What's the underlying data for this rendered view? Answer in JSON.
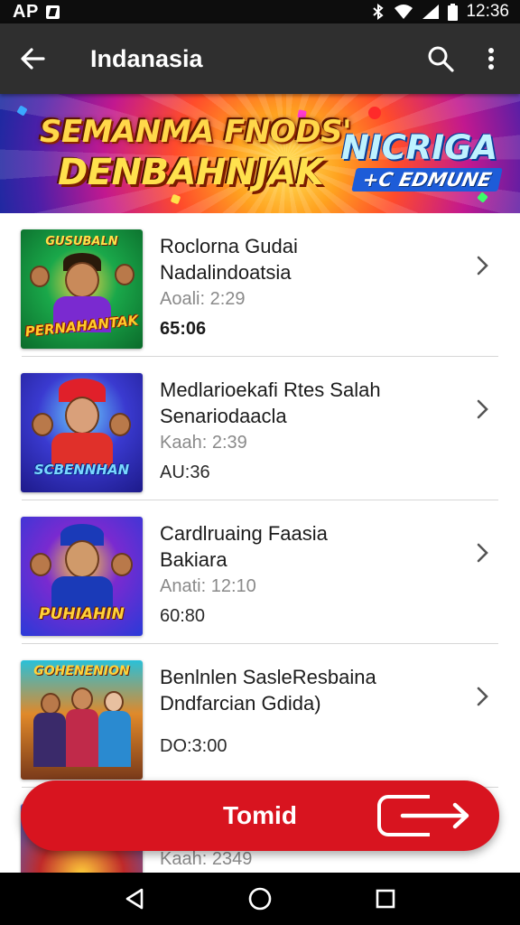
{
  "status_bar": {
    "left_label": "AP",
    "time": "12:36",
    "icons": [
      "notification-icon",
      "bluetooth-icon",
      "wifi-icon",
      "signal-icon",
      "battery-icon"
    ]
  },
  "app_bar": {
    "title": "Indanasia",
    "icons": [
      "back-arrow-icon",
      "search-icon",
      "more-vert-icon"
    ]
  },
  "banner": {
    "line1": "SEMANMA FNODS'",
    "line2": "DENBAHNJAK",
    "right_line1": "NICRIGA",
    "right_line2": "+C EDMUNE"
  },
  "items": [
    {
      "title_line1": "Roclorna Gudai",
      "title_line2": "Nadalindoatsia",
      "meta": "Aoali: 2:29",
      "duration": "65:06",
      "thumb_text_top": "GUSUBALN",
      "thumb_text_bottom": "PERNAHANTAK",
      "thumb_colors": [
        "#1aa84a",
        "#0b6b2b",
        "#f2c230"
      ]
    },
    {
      "title_line1": "Medlarioekafi Rtes Salah",
      "title_line2": "Senariodaacla",
      "meta": "Kaah: 2:39",
      "duration": "AU:36",
      "thumb_text_top": "",
      "thumb_text_bottom": "SCBENNHAN",
      "thumb_colors": [
        "#3a3ad0",
        "#1d1a8a",
        "#ff3a2a"
      ]
    },
    {
      "title_line1": "Cardlruaing Faasia",
      "title_line2": "Bakiara",
      "meta": "Anati: 12:10",
      "duration": "60:80",
      "thumb_text_top": "",
      "thumb_text_bottom": "PUHIAHIN",
      "thumb_colors": [
        "#2a3ad8",
        "#7a2ad0",
        "#ffd23a"
      ]
    },
    {
      "title_line1": "Benlnlen SasleResbaina",
      "title_line2": "Dndfarcian Gdida)",
      "meta": "",
      "duration": "DO:3:00",
      "thumb_text_top": "GOHENENION",
      "thumb_text_bottom": "",
      "thumb_colors": [
        "#e0892a",
        "#7a3a1a",
        "#2ac0d8"
      ]
    },
    {
      "title_line1": "",
      "title_line2": "",
      "meta": "Kaah: 2349",
      "duration": "",
      "thumb_text_top": "",
      "thumb_text_bottom": "",
      "thumb_colors": [
        "#3a6ad8",
        "#c02a2a",
        "#ffd23a"
      ]
    }
  ],
  "fab": {
    "label": "Tomid",
    "icon": "exit-arrow-icon",
    "color": "#d8141f"
  },
  "nav_bar": {
    "icons": [
      "back-triangle-icon",
      "home-circle-icon",
      "recents-square-icon"
    ]
  },
  "colors": {
    "app_bar": "#2f2f2f",
    "status_bar": "#0d0d0d",
    "accent_red": "#d8141f"
  }
}
